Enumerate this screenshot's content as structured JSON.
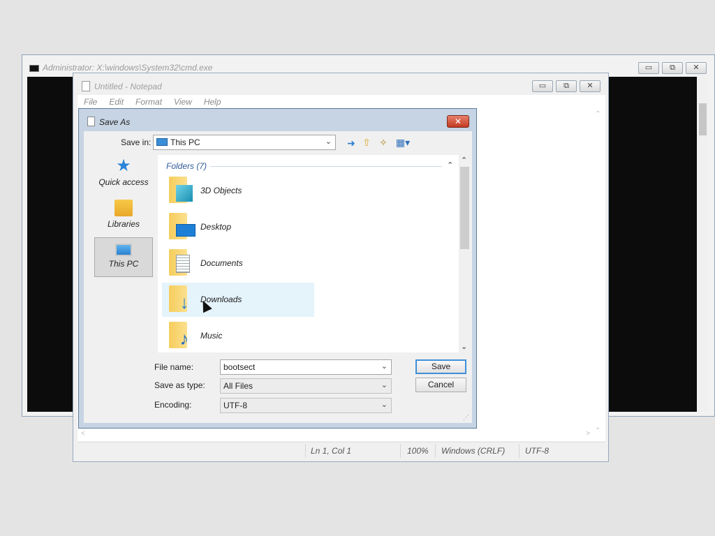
{
  "cmd_window": {
    "title": "Administrator: X:\\windows\\System32\\cmd.exe",
    "minimize": "▭",
    "restore": "⧉",
    "close": "✕"
  },
  "notepad": {
    "title": "Untitled - Notepad",
    "menu": [
      "File",
      "Edit",
      "Format",
      "View",
      "Help"
    ],
    "status": {
      "position": "Ln 1, Col 1",
      "zoom": "100%",
      "line_ending": "Windows (CRLF)",
      "encoding": "UTF-8"
    }
  },
  "save_as": {
    "title": "Save As",
    "save_in_label": "Save in:",
    "save_in_value": "This PC",
    "places": [
      {
        "label": "Quick access",
        "icon": "star-icon"
      },
      {
        "label": "Libraries",
        "icon": "libraries-icon"
      },
      {
        "label": "This PC",
        "icon": "computer-icon",
        "selected": true
      }
    ],
    "folders_header": "Folders (7)",
    "folders": [
      {
        "name": "3D Objects",
        "icon": "3d-objects-icon"
      },
      {
        "name": "Desktop",
        "icon": "desktop-icon"
      },
      {
        "name": "Documents",
        "icon": "documents-icon"
      },
      {
        "name": "Downloads",
        "icon": "downloads-icon",
        "hover": true
      },
      {
        "name": "Music",
        "icon": "music-icon"
      }
    ],
    "file_name_label": "File name:",
    "file_name_value": "bootsect",
    "save_type_label": "Save as type:",
    "save_type_value": "All Files",
    "encoding_label": "Encoding:",
    "encoding_value": "UTF-8",
    "save_button": "Save",
    "cancel_button": "Cancel"
  },
  "colors": {
    "dialog_frame": "#c6d4e4",
    "folder_yellow": "#f5cd5c",
    "accent_blue": "#3f8fd6",
    "close_red": "#c23a22"
  }
}
